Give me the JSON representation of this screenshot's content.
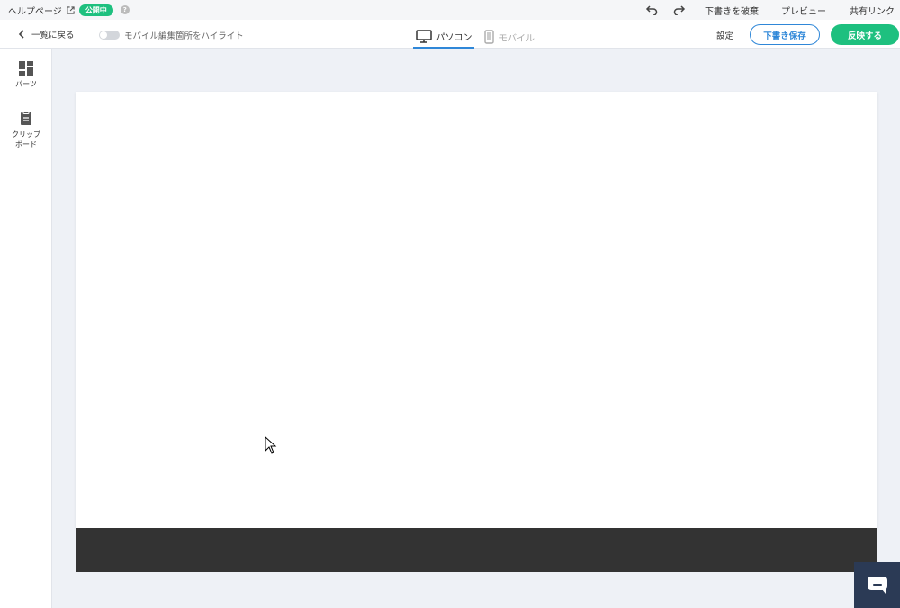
{
  "topbar": {
    "page_name": "ヘルプページ",
    "status_badge": "公開中",
    "help_glyph": "?",
    "discard_label": "下書きを破棄",
    "preview_label": "プレビュー",
    "share_label": "共有リンク"
  },
  "toolbar": {
    "back_label": "一覧に戻る",
    "highlight_toggle_label": "モバイル編集箇所をハイライト",
    "highlight_toggle_on": false,
    "tab_pc_label": "パソコン",
    "tab_mobile_label": "モバイル",
    "settings_label": "設定",
    "save_label": "下書き保存",
    "publish_label": "反映する"
  },
  "sidebar": {
    "items": [
      {
        "label": "パーツ",
        "icon": "parts-grid-icon"
      },
      {
        "label": "クリップ\nボード",
        "icon": "clipboard-icon"
      }
    ]
  },
  "colors": {
    "accent": "#2f87d8",
    "success": "#1ec07f",
    "footer": "#333333",
    "chat": "#2b3a55"
  }
}
